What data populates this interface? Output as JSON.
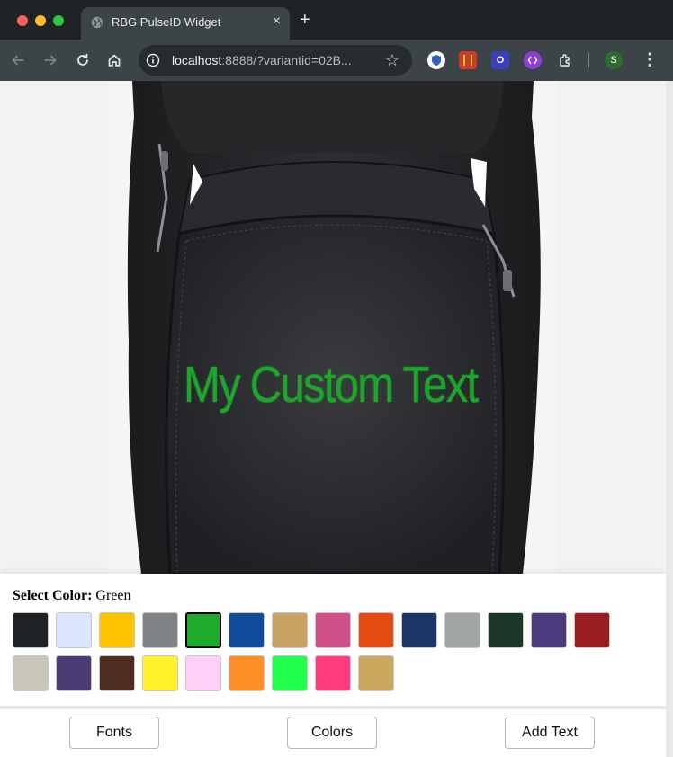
{
  "browser": {
    "tab_title": "RBG PulseID Widget",
    "tab_close": "×",
    "new_tab": "+",
    "url_host": "localhost",
    "url_rest": ":8888/?variantid=02B...",
    "star_icon": "☆",
    "profile_initial": "S",
    "menu_icon": "⋮",
    "extensions": [
      {
        "icon": "shield-extension-icon",
        "color": "#ffffff"
      },
      {
        "icon": "red-book-extension-icon",
        "color": "#d13a2a"
      },
      {
        "icon": "o-extension-icon",
        "color": "#3b3fbf",
        "text": "O"
      },
      {
        "icon": "purple-circle-extension-icon",
        "color": "#8b3fd6"
      },
      {
        "icon": "puzzle-icon",
        "color": "#e6e8ea"
      }
    ]
  },
  "product": {
    "custom_text": "My Custom Text",
    "text_color": "#1fa52e"
  },
  "color_panel": {
    "label": "Select Color:",
    "selected": "Green",
    "swatches": [
      {
        "name": "Black",
        "hex": "#1e2225"
      },
      {
        "name": "Light Blue",
        "hex": "#dde6ff"
      },
      {
        "name": "Gold",
        "hex": "#ffc400"
      },
      {
        "name": "Gray",
        "hex": "#808487"
      },
      {
        "name": "Green",
        "hex": "#1eaa2a",
        "selected": true
      },
      {
        "name": "Royal Blue",
        "hex": "#124a9c"
      },
      {
        "name": "Tan",
        "hex": "#c7a364"
      },
      {
        "name": "Pink",
        "hex": "#cf4f8a"
      },
      {
        "name": "Orange",
        "hex": "#e24b12"
      },
      {
        "name": "Navy",
        "hex": "#1b3666"
      },
      {
        "name": "Silver",
        "hex": "#a2a7a3"
      },
      {
        "name": "Dark Green",
        "hex": "#1d3526"
      },
      {
        "name": "Purple",
        "hex": "#4b3b7c"
      },
      {
        "name": "Maroon",
        "hex": "#9b1f22"
      },
      {
        "name": "Khaki",
        "hex": "#cac5b9"
      },
      {
        "name": "Violet",
        "hex": "#4a3b77"
      },
      {
        "name": "Brown",
        "hex": "#4b2d21"
      },
      {
        "name": "Yellow",
        "hex": "#fff12b"
      },
      {
        "name": "Light Pink",
        "hex": "#ffcff7"
      },
      {
        "name": "Light Orange",
        "hex": "#ff8f26"
      },
      {
        "name": "Bright Green",
        "hex": "#21ff4c"
      },
      {
        "name": "Hot Pink",
        "hex": "#ff3b80"
      },
      {
        "name": "Old Gold",
        "hex": "#c9a85e"
      }
    ]
  },
  "buttons": {
    "fonts": "Fonts",
    "colors": "Colors",
    "add_text": "Add Text"
  }
}
